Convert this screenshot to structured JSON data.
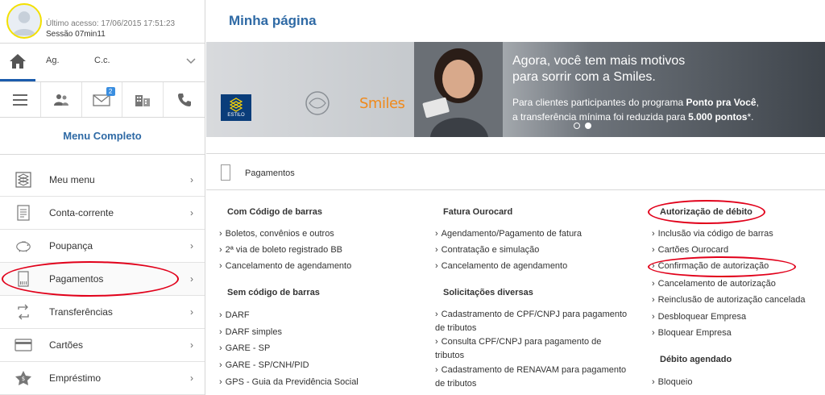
{
  "user": {
    "last_access": "Último acesso: 17/06/2015 17:51:23",
    "session": "Sessão 07min11"
  },
  "account": {
    "ag_label": "Ag.",
    "cc_label": "C.c."
  },
  "icon_bar": {
    "messages_badge": "2",
    "icons": [
      "menu-icon",
      "people-icon",
      "envelope-icon",
      "buildings-icon",
      "phone-icon"
    ]
  },
  "menu_completo": "Menu Completo",
  "menu": {
    "items": [
      {
        "label": "Meu menu",
        "icon": "bb-logo-icon",
        "chevron": "›"
      },
      {
        "label": "Conta-corrente",
        "icon": "document-icon",
        "chevron": "›"
      },
      {
        "label": "Poupança",
        "icon": "piggy-bank-icon",
        "chevron": "›"
      },
      {
        "label": "Pagamentos",
        "icon": "barcode-icon",
        "chevron": "›"
      },
      {
        "label": "Transferências",
        "icon": "transfer-icon",
        "chevron": "›"
      },
      {
        "label": "Cartões",
        "icon": "card-icon",
        "chevron": "›"
      },
      {
        "label": "Empréstimo",
        "icon": "loan-icon",
        "chevron": "›"
      }
    ]
  },
  "main": {
    "page_title": "Minha página",
    "banner": {
      "headline_line1": "Agora, você tem mais motivos",
      "headline_line2": "para sorrir com a Smiles.",
      "text_part1": "Para clientes participantes do programa ",
      "text_bold1": "Ponto pra Você",
      "text_part2": ",",
      "text_part3": "a transferência mínima foi reduzida para ",
      "text_bold2": "5.000 pontos",
      "text_part4": "*.",
      "bb_logo_text": "ESTILO",
      "smiles_logo": "Smiles"
    },
    "section_title": "Pagamentos"
  },
  "columns": {
    "col1": {
      "heading1": "Com Código de barras",
      "links1": [
        "Boletos, convênios e outros",
        "2ª via de boleto registrado BB",
        "Cancelamento de agendamento"
      ],
      "heading2": "Sem código de barras",
      "links2": [
        "DARF",
        "DARF simples",
        "GARE - SP",
        "GARE - SP/CNH/PID",
        "GPS - Guia da Previdência Social"
      ]
    },
    "col2": {
      "heading1": "Fatura Ourocard",
      "links1": [
        "Agendamento/Pagamento de fatura",
        "Contratação e simulação",
        "Cancelamento de agendamento"
      ],
      "heading2": "Solicitações diversas",
      "links2": [
        "Cadastramento de CPF/CNPJ para pagamento de tributos",
        "Consulta CPF/CNPJ para pagamento de tributos",
        "Cadastramento de RENAVAM para pagamento de tributos"
      ]
    },
    "col3": {
      "heading1": "Autorização de débito",
      "links1": [
        "Inclusão via código de barras",
        "Cartões Ourocard",
        "Confirmação de autorização",
        "Cancelamento de autorização",
        "Reinclusão de autorização cancelada",
        "Desbloquear Empresa",
        "Bloquear Empresa"
      ],
      "heading2": "Débito agendado",
      "links2": [
        "Bloqueio"
      ]
    }
  },
  "colors": {
    "accent_blue": "#2f6aa5",
    "annotation_red": "#e1001a",
    "avatar_ring": "#f3e000",
    "smiles_orange": "#f08a1c"
  }
}
